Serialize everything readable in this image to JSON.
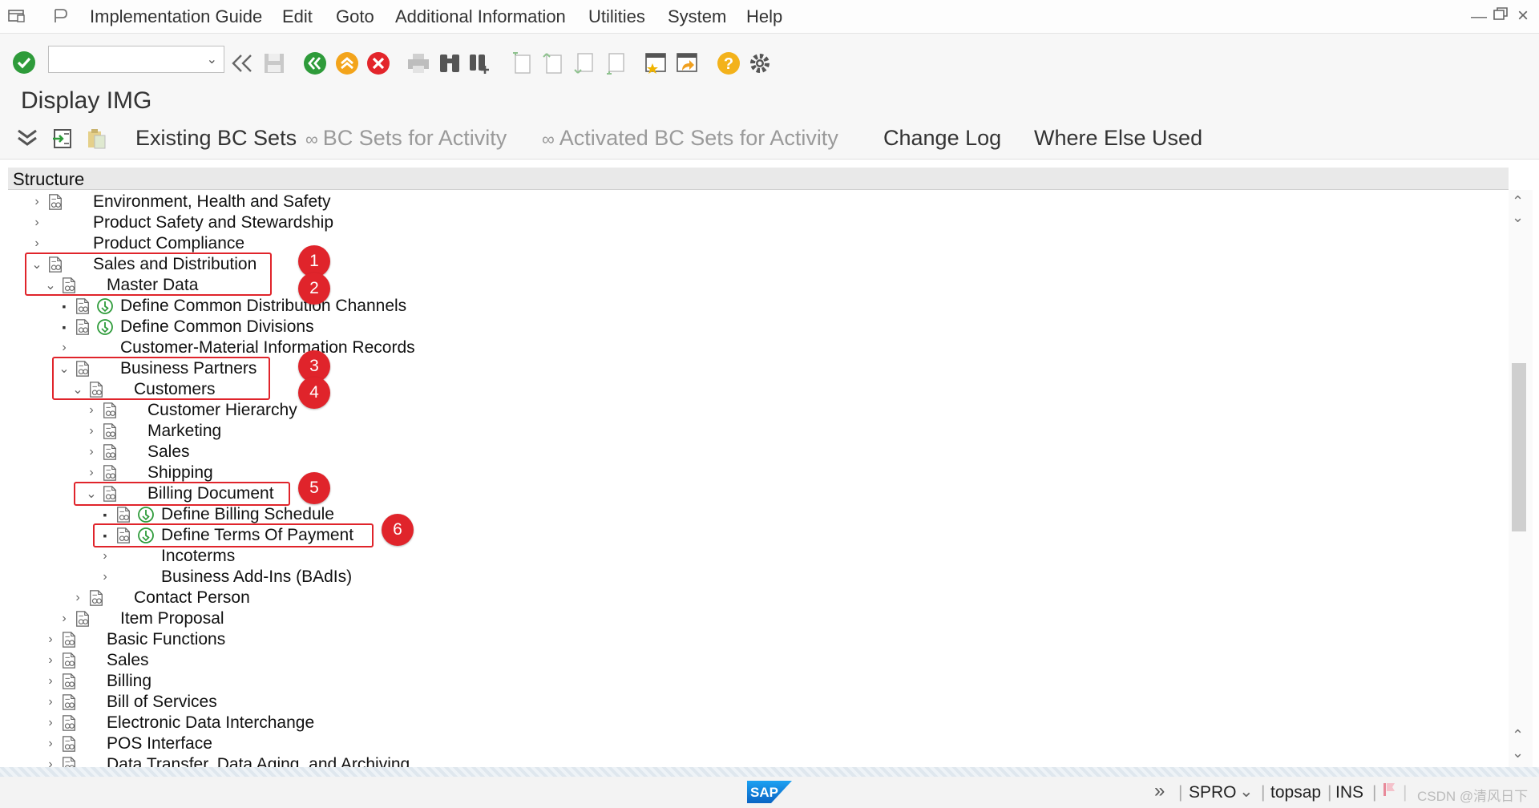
{
  "menubar": {
    "items": [
      "Implementation Guide",
      "Edit",
      "Goto",
      "Additional Information",
      "Utilities",
      "System",
      "Help"
    ]
  },
  "toolbar": {
    "command_field_value": ""
  },
  "page": {
    "title": "Display IMG"
  },
  "app_toolbar": {
    "existing_bc_sets": "Existing BC Sets",
    "bc_sets_for_activity": "BC Sets for Activity",
    "activated_bc_sets": "Activated BC Sets for Activity",
    "change_log": "Change Log",
    "where_else_used": "Where Else Used"
  },
  "tree": {
    "header": "Structure",
    "nodes": [
      {
        "label": "Environment, Health and Safety"
      },
      {
        "label": "Product Safety and Stewardship"
      },
      {
        "label": "Product Compliance"
      },
      {
        "label": "Sales and Distribution"
      },
      {
        "label": "Master Data"
      },
      {
        "label": "Define Common Distribution Channels"
      },
      {
        "label": "Define Common Divisions"
      },
      {
        "label": "Customer-Material Information Records"
      },
      {
        "label": "Business Partners"
      },
      {
        "label": "Customers"
      },
      {
        "label": "Customer Hierarchy"
      },
      {
        "label": "Marketing"
      },
      {
        "label": "Sales"
      },
      {
        "label": "Shipping"
      },
      {
        "label": "Billing Document"
      },
      {
        "label": "Define Billing Schedule"
      },
      {
        "label": "Define Terms Of Payment"
      },
      {
        "label": "Incoterms"
      },
      {
        "label": "Business Add-Ins (BAdIs)"
      },
      {
        "label": "Contact Person"
      },
      {
        "label": "Item Proposal"
      },
      {
        "label": "Basic Functions"
      },
      {
        "label": "Sales"
      },
      {
        "label": "Billing"
      },
      {
        "label": "Bill of Services"
      },
      {
        "label": "Electronic Data Interchange"
      },
      {
        "label": "POS Interface"
      },
      {
        "label": "Data Transfer, Data Aging, and Archiving"
      }
    ]
  },
  "annotations": [
    "1",
    "2",
    "3",
    "4",
    "5",
    "6"
  ],
  "statusbar": {
    "transaction": "SPRO",
    "server": "topsap",
    "mode": "INS",
    "watermark": "CSDN @清风日下"
  },
  "colors": {
    "highlight_red": "#e0242b",
    "ok_green": "#2e9b3a",
    "cancel_red": "#e3252b",
    "help_yellow": "#f3b21b"
  }
}
